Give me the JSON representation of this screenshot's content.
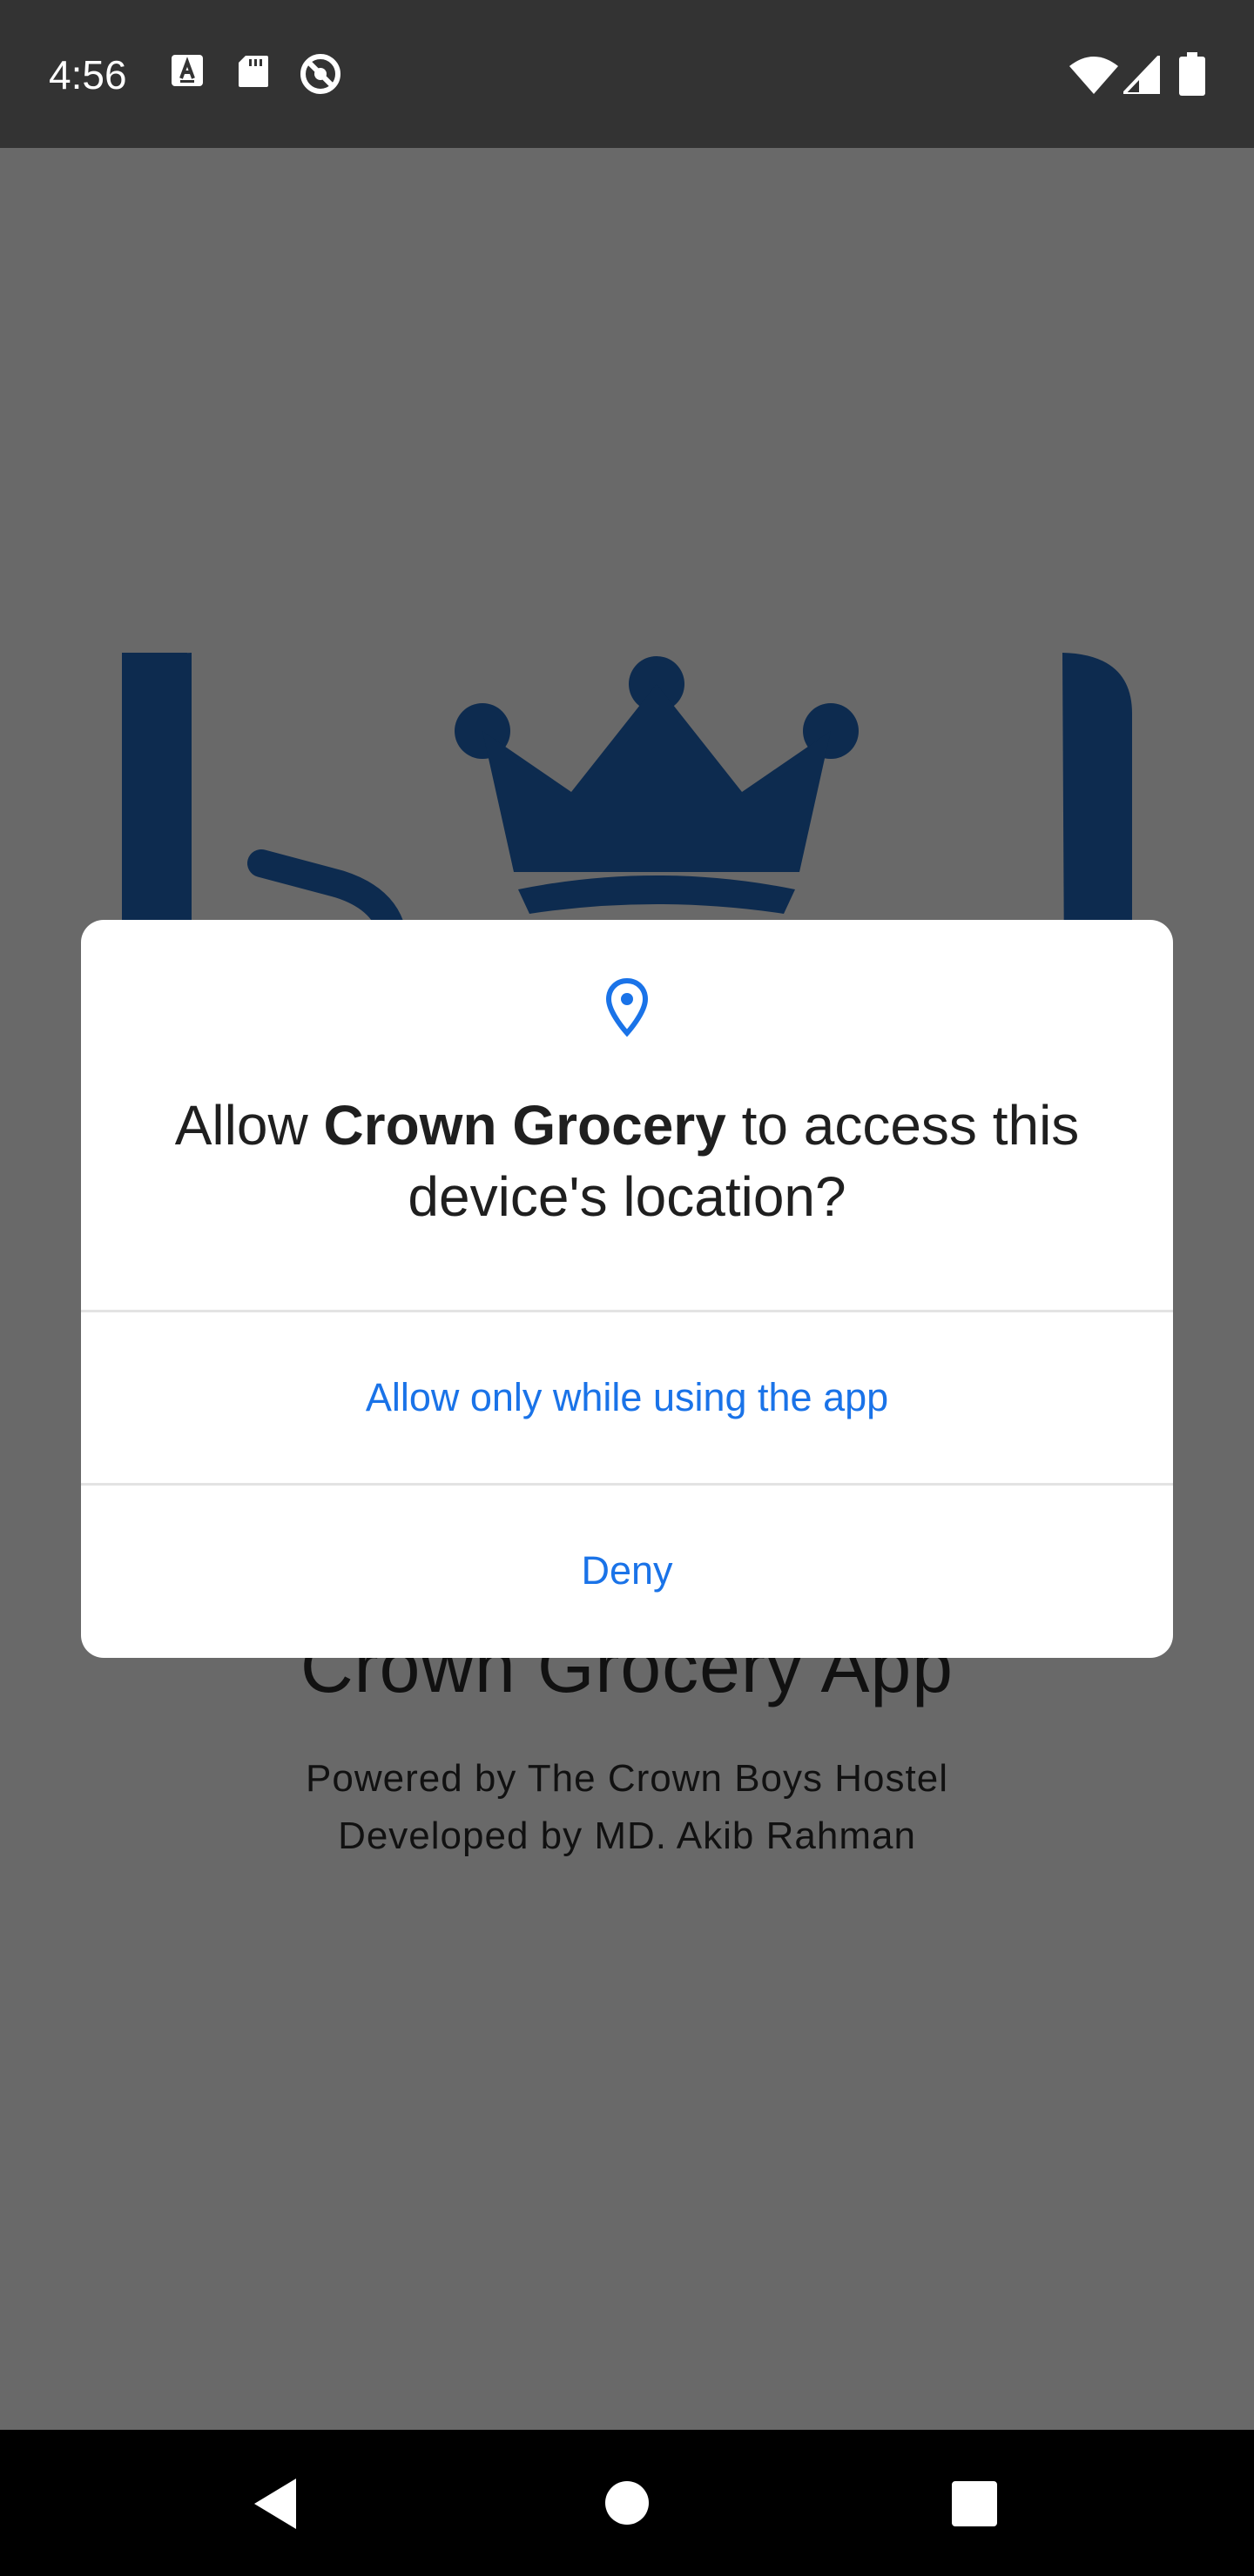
{
  "status_bar": {
    "time": "4:56",
    "icons_left": [
      "accessibility-a-icon",
      "sd-card-icon",
      "do-not-disturb-icon"
    ],
    "icons_right": [
      "wifi-icon",
      "cellular-signal-icon",
      "battery-icon"
    ]
  },
  "app": {
    "title": "Crown Grocery App",
    "powered_by": "Powered by The Crown Boys Hostel",
    "developed_by": "Developed by MD. Akib Rahman",
    "logo_color": "#0d2b4f"
  },
  "dialog": {
    "icon": "location-pin-icon",
    "title_prefix": "Allow ",
    "title_app": "Crown Grocery",
    "title_suffix": " to access this device's location?",
    "allow_label": "Allow only while using the app",
    "deny_label": "Deny",
    "accent_color": "#1a73e8"
  },
  "nav_bar": {
    "buttons": [
      "back-icon",
      "home-icon",
      "recents-icon"
    ]
  }
}
